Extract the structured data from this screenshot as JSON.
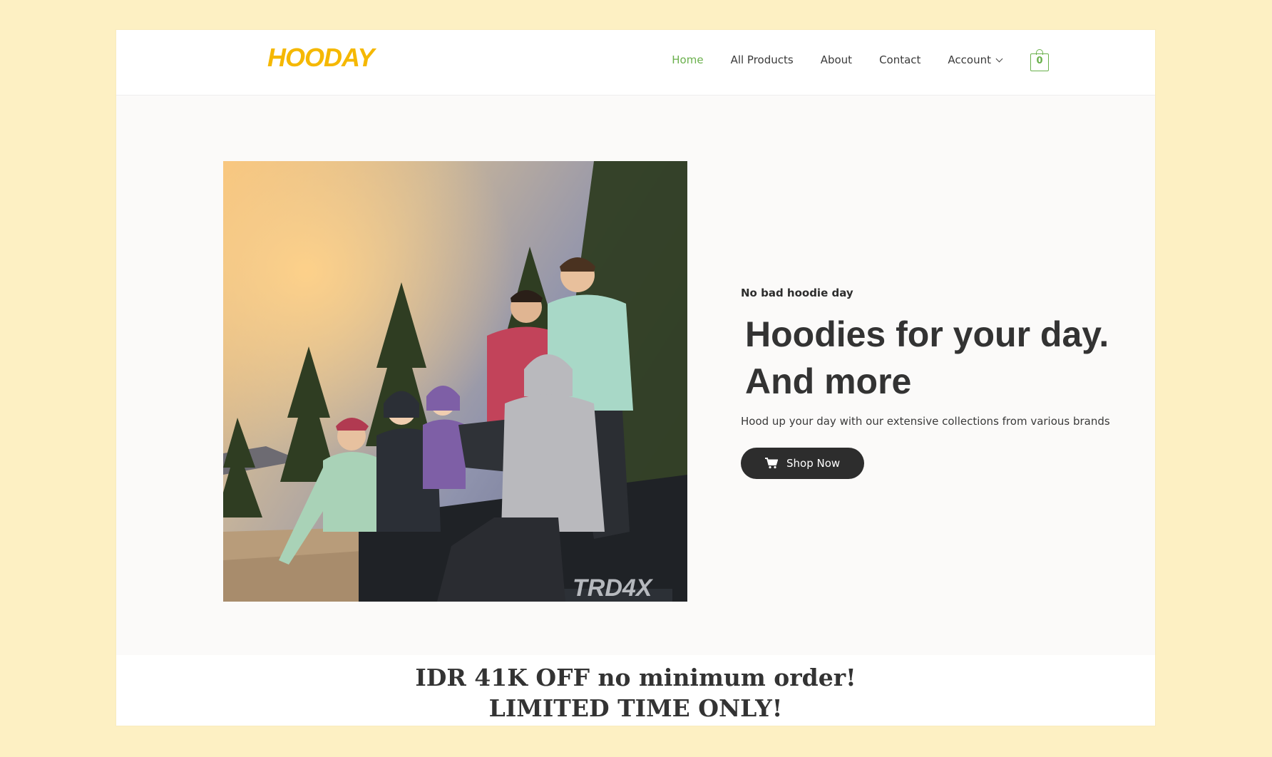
{
  "brand": {
    "logo_text": "HOODAY"
  },
  "nav": {
    "items": [
      {
        "label": "Home",
        "active": true
      },
      {
        "label": "All Products",
        "active": false
      },
      {
        "label": "About",
        "active": false
      },
      {
        "label": "Contact",
        "active": false
      },
      {
        "label": "Account",
        "active": false
      }
    ],
    "cart_count": "0"
  },
  "hero": {
    "eyebrow": "No bad hoodie day",
    "headline_line1": "Hoodies for your day.",
    "headline_line2": "And more",
    "subtext": "Hood up your day with our extensive collections from various brands",
    "cta_label": "Shop Now"
  },
  "promo": {
    "line1": "IDR 41K OFF no minimum order!",
    "line2": "LIMITED TIME ONLY!"
  },
  "colors": {
    "page_background": "#fdf0c3",
    "accent_green": "#6ab04c",
    "logo_yellow": "#f5b800",
    "button_dark": "#2d2d2d",
    "text_dark": "#333333"
  },
  "icons": {
    "cart": "shopping-bag-icon",
    "cta": "shopping-cart-icon",
    "account_dropdown": "chevron-down-icon"
  }
}
